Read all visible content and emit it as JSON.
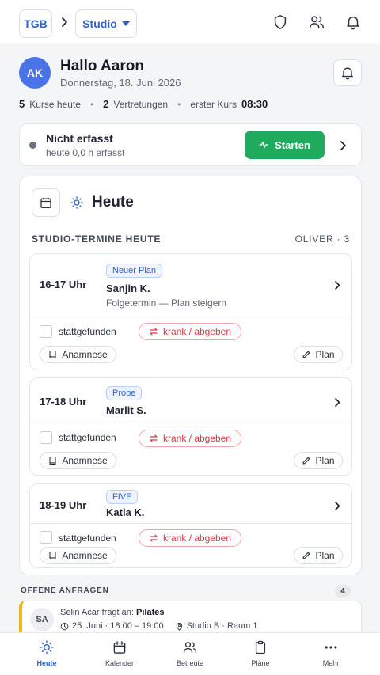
{
  "header": {
    "org_label": "TGB",
    "studio_label": "Studio",
    "icons": [
      "shield-icon",
      "users-icon",
      "bell-icon"
    ]
  },
  "greeting": {
    "avatar_initials": "AK",
    "hello": "Hallo Aaron",
    "date": "Donnerstag, 18. Juni 2026"
  },
  "stats": {
    "courses_count": "5",
    "courses_label": "Kurse heute",
    "subs_count": "2",
    "subs_label": "Vertretungen",
    "first_course_label": "erster Kurs",
    "first_course_time": "08:30"
  },
  "tracking": {
    "title": "Nicht erfasst",
    "subtitle": "heute 0,0 h erfasst",
    "start_label": "Starten",
    "status_color": "#6b7280",
    "accent": "#1faa5e"
  },
  "today": {
    "title": "Heute",
    "section_label": "STUDIO-TERMINE HEUTE",
    "section_right": "OLIVER · 3",
    "appointments": [
      {
        "time": "16-17 Uhr",
        "badge": "Neuer Plan",
        "name": "Sanjin K.",
        "note": "Folgetermin — Plan steigern",
        "check_label": "stattgefunden",
        "sick_label": "krank / abgeben",
        "anamnesis_label": "Anamnese",
        "plan_label": "Plan"
      },
      {
        "time": "17-18 Uhr",
        "badge": "Probe",
        "name": "Marlit S.",
        "check_label": "stattgefunden",
        "sick_label": "krank / abgeben",
        "anamnesis_label": "Anamnese",
        "plan_label": "Plan"
      },
      {
        "time": "18-19 Uhr",
        "badge": "FIVE",
        "name": "Katia K.",
        "check_label": "stattgefunden",
        "sick_label": "krank / abgeben",
        "anamnesis_label": "Anamnese",
        "plan_label": "Plan"
      }
    ]
  },
  "requests": {
    "label": "OFFENE ANFRAGEN",
    "count": "4",
    "items": [
      {
        "initials": "SA",
        "requester": "Selin Acar",
        "asks_for": "fragt an:",
        "course": "Pilates",
        "time": "25. Juni · 18:00 – 19:00",
        "location": "Studio B · Raum 1",
        "accent": "#f3b31a"
      }
    ]
  },
  "nav": {
    "items": [
      {
        "label": "Heute",
        "icon": "sun-icon",
        "active": true
      },
      {
        "label": "Kalender",
        "icon": "calendar-icon"
      },
      {
        "label": "Betreute",
        "icon": "users-icon"
      },
      {
        "label": "Pläne",
        "icon": "clipboard-icon"
      },
      {
        "label": "Mehr",
        "icon": "more-icon"
      }
    ]
  }
}
